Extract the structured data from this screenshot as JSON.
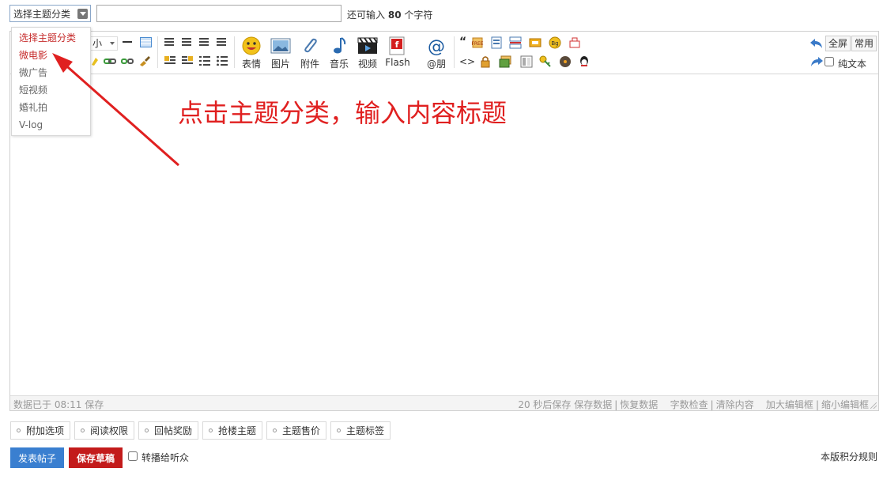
{
  "header": {
    "category_selected": "选择主题分类",
    "title_value": "",
    "title_placeholder": "",
    "char_hint_prefix": "还可输入",
    "char_hint_count": "80",
    "char_hint_suffix": "个字符"
  },
  "category_options": [
    "选择主题分类",
    "微电影",
    "微广告",
    "短视频",
    "婚礼拍",
    "V-log"
  ],
  "toolbar": {
    "font_size_label": "小",
    "buttons": {
      "emoticon": "表情",
      "image": "图片",
      "attachment": "附件",
      "music": "音乐",
      "video": "视频",
      "flash": "Flash",
      "mention": "@朋"
    },
    "fullscreen": "全屏",
    "common": "常用",
    "plain_text": "纯文本"
  },
  "status_bar": {
    "left": "数据已于 08:11 保存",
    "autosave": "20 秒后保存",
    "save_data": "保存数据",
    "restore_data": "恢复数据",
    "word_check": "字数检查",
    "clear_content": "清除内容",
    "enlarge": "加大编辑框",
    "shrink": "缩小编辑框"
  },
  "annotation": "点击主题分类，输入内容标题",
  "option_tabs": [
    "附加选项",
    "阅读权限",
    "回帖奖励",
    "抢楼主题",
    "主题售价",
    "主题标签"
  ],
  "actions": {
    "publish": "发表帖子",
    "save_draft": "保存草稿",
    "relay": "转播给听众",
    "rules": "本版积分规则"
  },
  "colors": {
    "accent_blue": "#3a7fd0",
    "draft_red": "#c31b1b",
    "annotation_red": "#e02020"
  }
}
